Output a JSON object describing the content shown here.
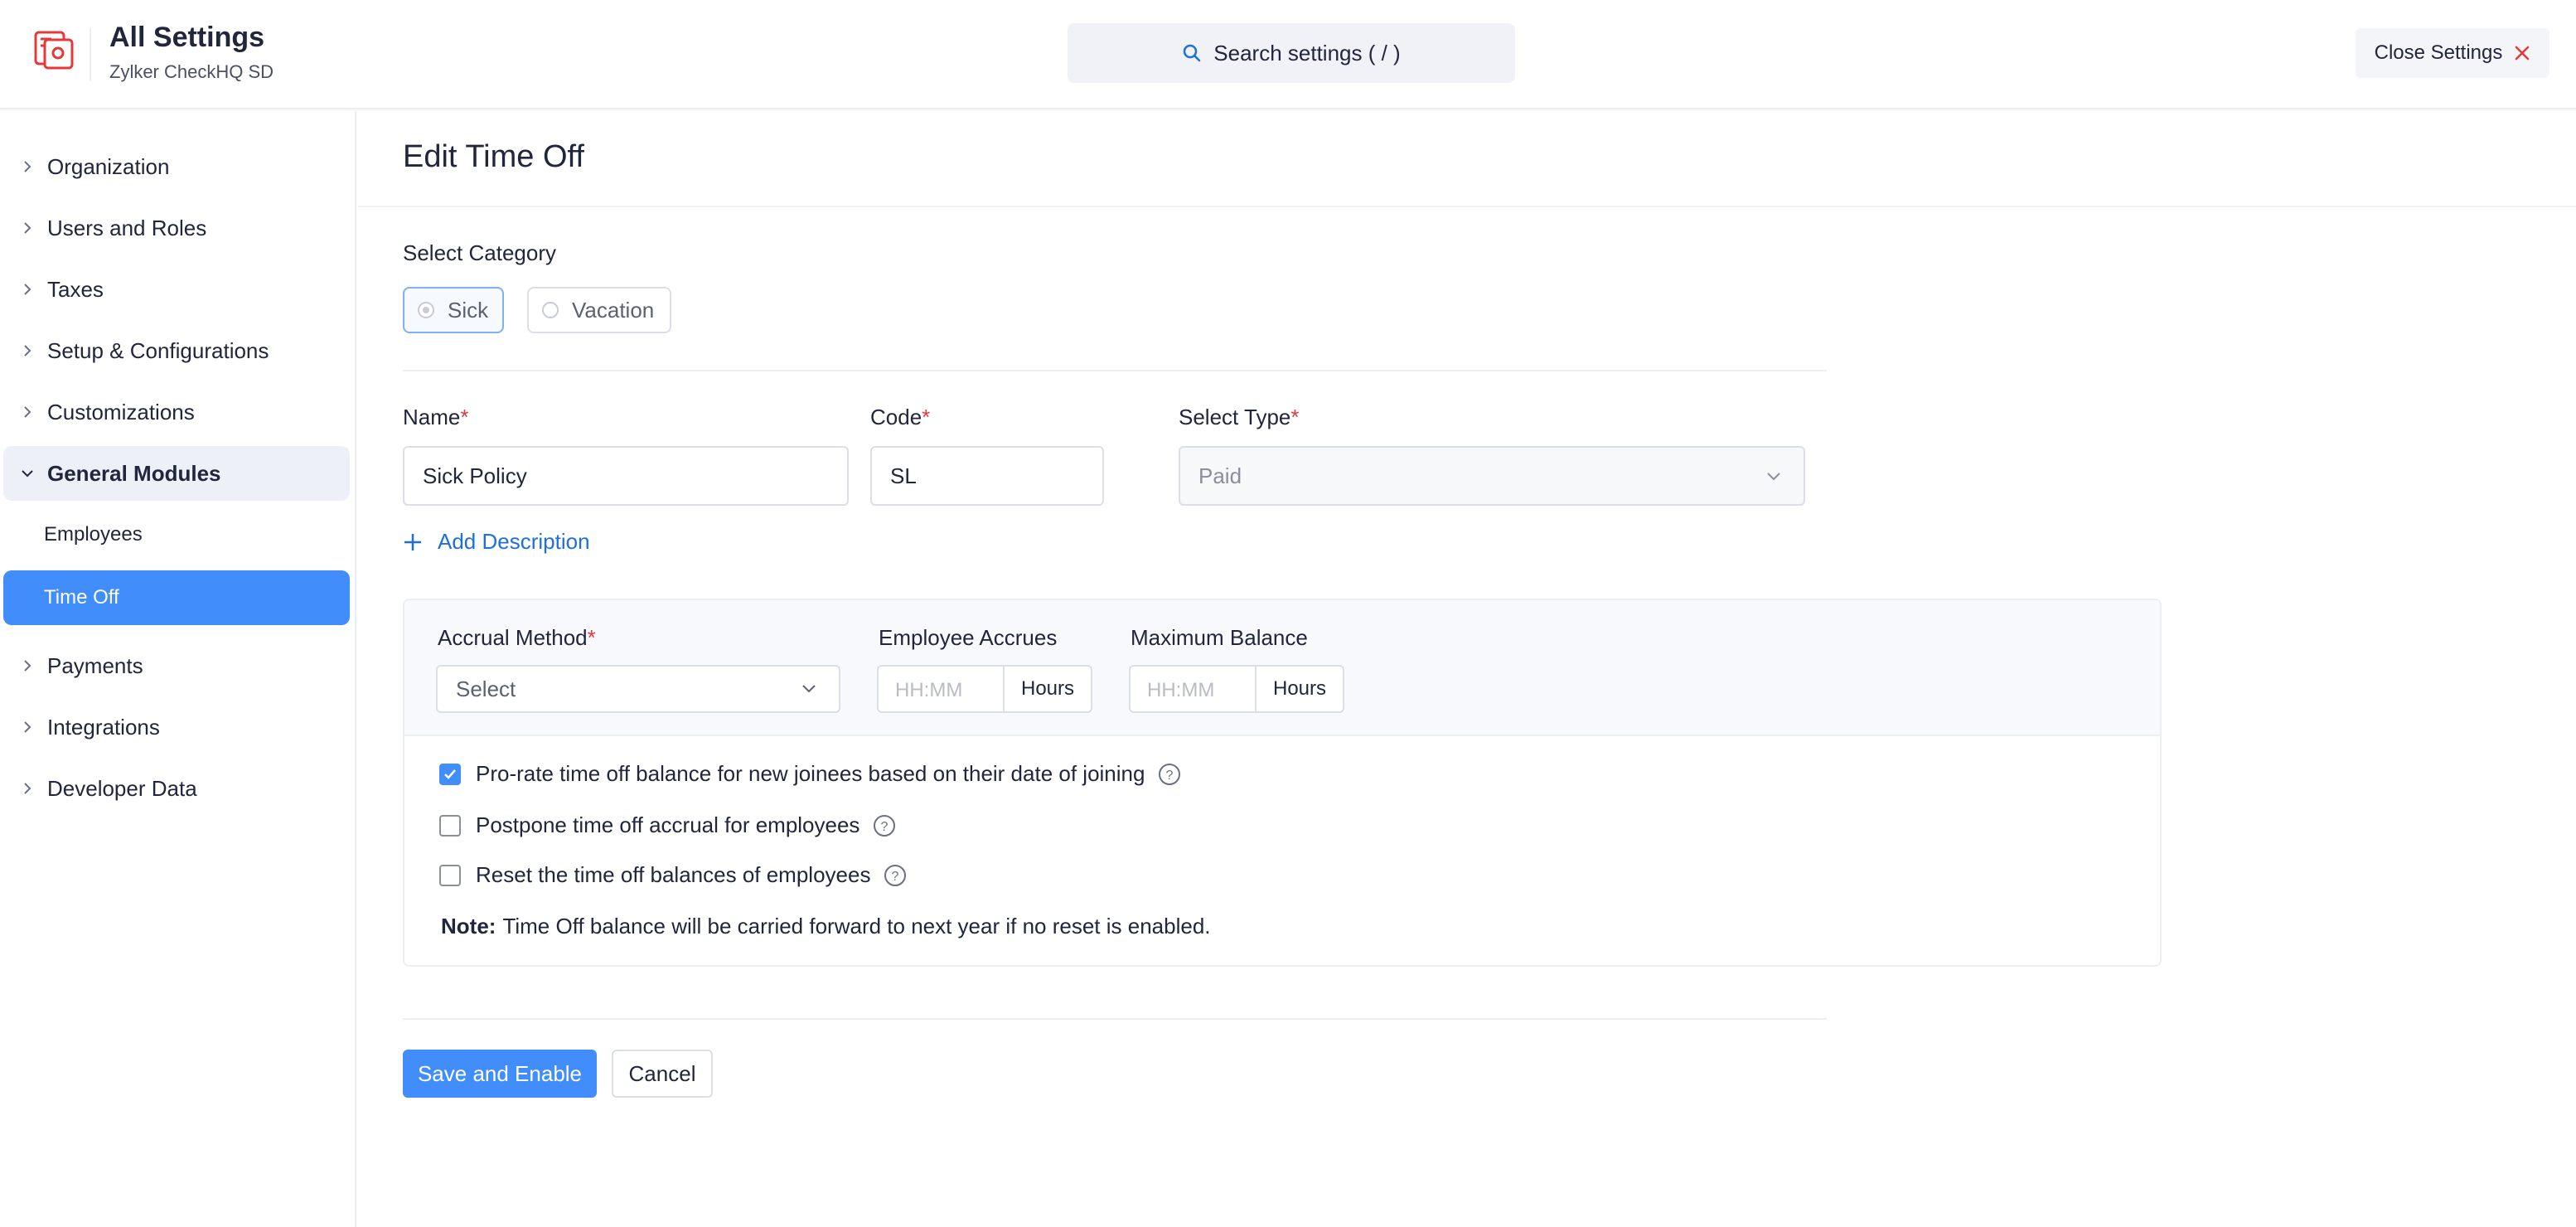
{
  "header": {
    "title": "All Settings",
    "subtitle": "Zylker CheckHQ SD",
    "search_placeholder": "Search settings ( / )",
    "close_label": "Close Settings"
  },
  "sidebar": {
    "items": [
      {
        "label": "Organization"
      },
      {
        "label": "Users and Roles"
      },
      {
        "label": "Taxes"
      },
      {
        "label": "Setup & Configurations"
      },
      {
        "label": "Customizations"
      },
      {
        "label": "General Modules"
      },
      {
        "label": "Payments"
      },
      {
        "label": "Integrations"
      },
      {
        "label": "Developer Data"
      }
    ],
    "sub_items": [
      {
        "label": "Employees"
      },
      {
        "label": "Time Off"
      }
    ]
  },
  "main": {
    "title": "Edit Time Off",
    "category_label": "Select Category",
    "categories": [
      {
        "label": "Sick",
        "selected": true
      },
      {
        "label": "Vacation",
        "selected": false
      }
    ],
    "name_label": "Name",
    "name_value": "Sick Policy",
    "code_label": "Code",
    "code_value": "SL",
    "type_label": "Select Type",
    "type_value": "Paid",
    "required_mark": "*",
    "add_description": "Add Description",
    "accrual": {
      "method_label": "Accrual Method",
      "method_placeholder": "Select",
      "accrues_label": "Employee Accrues",
      "accrues_placeholder": "HH:MM",
      "accrues_unit": "Hours",
      "max_label": "Maximum Balance",
      "max_placeholder": "HH:MM",
      "max_unit": "Hours"
    },
    "options": [
      {
        "label": "Pro-rate time off balance for new joinees based on their date of joining",
        "checked": true
      },
      {
        "label": "Postpone time off accrual for employees",
        "checked": false
      },
      {
        "label": "Reset the time off balances of employees",
        "checked": false
      }
    ],
    "note_prefix": "Note:",
    "note_text": "Time Off balance will be carried forward to next year if no reset is enabled.",
    "save_label": "Save and Enable",
    "cancel_label": "Cancel"
  },
  "colors": {
    "accent": "#408dfb",
    "link": "#1f6fdb",
    "required": "#e5383b",
    "close_icon": "#e5383b"
  },
  "icons": [
    "app-logo-icon",
    "search-icon",
    "close-icon",
    "chevron-right-icon",
    "chevron-down-icon",
    "plus-icon",
    "help-icon",
    "check-icon"
  ]
}
